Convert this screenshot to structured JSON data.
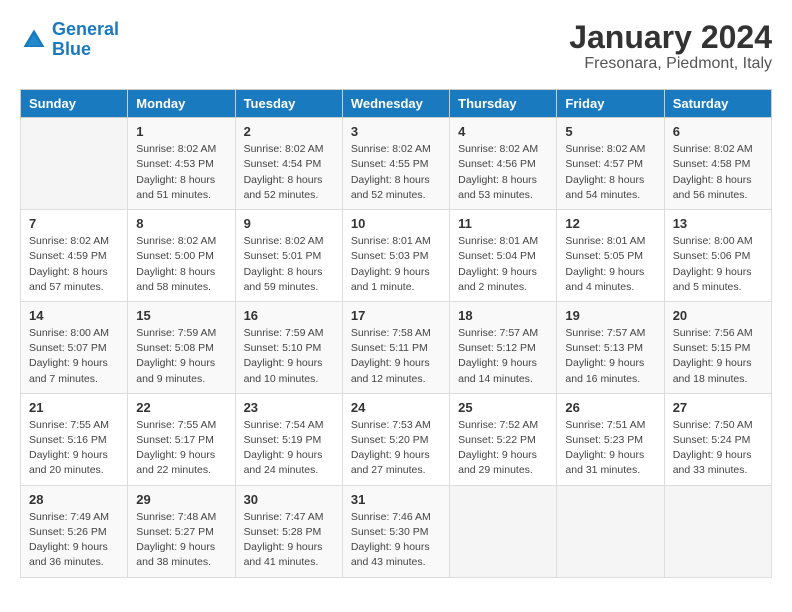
{
  "header": {
    "logo_line1": "General",
    "logo_line2": "Blue",
    "title": "January 2024",
    "subtitle": "Fresonara, Piedmont, Italy"
  },
  "calendar": {
    "days_of_week": [
      "Sunday",
      "Monday",
      "Tuesday",
      "Wednesday",
      "Thursday",
      "Friday",
      "Saturday"
    ],
    "weeks": [
      [
        {
          "day": "",
          "info": ""
        },
        {
          "day": "1",
          "info": "Sunrise: 8:02 AM\nSunset: 4:53 PM\nDaylight: 8 hours\nand 51 minutes."
        },
        {
          "day": "2",
          "info": "Sunrise: 8:02 AM\nSunset: 4:54 PM\nDaylight: 8 hours\nand 52 minutes."
        },
        {
          "day": "3",
          "info": "Sunrise: 8:02 AM\nSunset: 4:55 PM\nDaylight: 8 hours\nand 52 minutes."
        },
        {
          "day": "4",
          "info": "Sunrise: 8:02 AM\nSunset: 4:56 PM\nDaylight: 8 hours\nand 53 minutes."
        },
        {
          "day": "5",
          "info": "Sunrise: 8:02 AM\nSunset: 4:57 PM\nDaylight: 8 hours\nand 54 minutes."
        },
        {
          "day": "6",
          "info": "Sunrise: 8:02 AM\nSunset: 4:58 PM\nDaylight: 8 hours\nand 56 minutes."
        }
      ],
      [
        {
          "day": "7",
          "info": "Sunrise: 8:02 AM\nSunset: 4:59 PM\nDaylight: 8 hours\nand 57 minutes."
        },
        {
          "day": "8",
          "info": "Sunrise: 8:02 AM\nSunset: 5:00 PM\nDaylight: 8 hours\nand 58 minutes."
        },
        {
          "day": "9",
          "info": "Sunrise: 8:02 AM\nSunset: 5:01 PM\nDaylight: 8 hours\nand 59 minutes."
        },
        {
          "day": "10",
          "info": "Sunrise: 8:01 AM\nSunset: 5:03 PM\nDaylight: 9 hours\nand 1 minute."
        },
        {
          "day": "11",
          "info": "Sunrise: 8:01 AM\nSunset: 5:04 PM\nDaylight: 9 hours\nand 2 minutes."
        },
        {
          "day": "12",
          "info": "Sunrise: 8:01 AM\nSunset: 5:05 PM\nDaylight: 9 hours\nand 4 minutes."
        },
        {
          "day": "13",
          "info": "Sunrise: 8:00 AM\nSunset: 5:06 PM\nDaylight: 9 hours\nand 5 minutes."
        }
      ],
      [
        {
          "day": "14",
          "info": "Sunrise: 8:00 AM\nSunset: 5:07 PM\nDaylight: 9 hours\nand 7 minutes."
        },
        {
          "day": "15",
          "info": "Sunrise: 7:59 AM\nSunset: 5:08 PM\nDaylight: 9 hours\nand 9 minutes."
        },
        {
          "day": "16",
          "info": "Sunrise: 7:59 AM\nSunset: 5:10 PM\nDaylight: 9 hours\nand 10 minutes."
        },
        {
          "day": "17",
          "info": "Sunrise: 7:58 AM\nSunset: 5:11 PM\nDaylight: 9 hours\nand 12 minutes."
        },
        {
          "day": "18",
          "info": "Sunrise: 7:57 AM\nSunset: 5:12 PM\nDaylight: 9 hours\nand 14 minutes."
        },
        {
          "day": "19",
          "info": "Sunrise: 7:57 AM\nSunset: 5:13 PM\nDaylight: 9 hours\nand 16 minutes."
        },
        {
          "day": "20",
          "info": "Sunrise: 7:56 AM\nSunset: 5:15 PM\nDaylight: 9 hours\nand 18 minutes."
        }
      ],
      [
        {
          "day": "21",
          "info": "Sunrise: 7:55 AM\nSunset: 5:16 PM\nDaylight: 9 hours\nand 20 minutes."
        },
        {
          "day": "22",
          "info": "Sunrise: 7:55 AM\nSunset: 5:17 PM\nDaylight: 9 hours\nand 22 minutes."
        },
        {
          "day": "23",
          "info": "Sunrise: 7:54 AM\nSunset: 5:19 PM\nDaylight: 9 hours\nand 24 minutes."
        },
        {
          "day": "24",
          "info": "Sunrise: 7:53 AM\nSunset: 5:20 PM\nDaylight: 9 hours\nand 27 minutes."
        },
        {
          "day": "25",
          "info": "Sunrise: 7:52 AM\nSunset: 5:22 PM\nDaylight: 9 hours\nand 29 minutes."
        },
        {
          "day": "26",
          "info": "Sunrise: 7:51 AM\nSunset: 5:23 PM\nDaylight: 9 hours\nand 31 minutes."
        },
        {
          "day": "27",
          "info": "Sunrise: 7:50 AM\nSunset: 5:24 PM\nDaylight: 9 hours\nand 33 minutes."
        }
      ],
      [
        {
          "day": "28",
          "info": "Sunrise: 7:49 AM\nSunset: 5:26 PM\nDaylight: 9 hours\nand 36 minutes."
        },
        {
          "day": "29",
          "info": "Sunrise: 7:48 AM\nSunset: 5:27 PM\nDaylight: 9 hours\nand 38 minutes."
        },
        {
          "day": "30",
          "info": "Sunrise: 7:47 AM\nSunset: 5:28 PM\nDaylight: 9 hours\nand 41 minutes."
        },
        {
          "day": "31",
          "info": "Sunrise: 7:46 AM\nSunset: 5:30 PM\nDaylight: 9 hours\nand 43 minutes."
        },
        {
          "day": "",
          "info": ""
        },
        {
          "day": "",
          "info": ""
        },
        {
          "day": "",
          "info": ""
        }
      ]
    ]
  }
}
